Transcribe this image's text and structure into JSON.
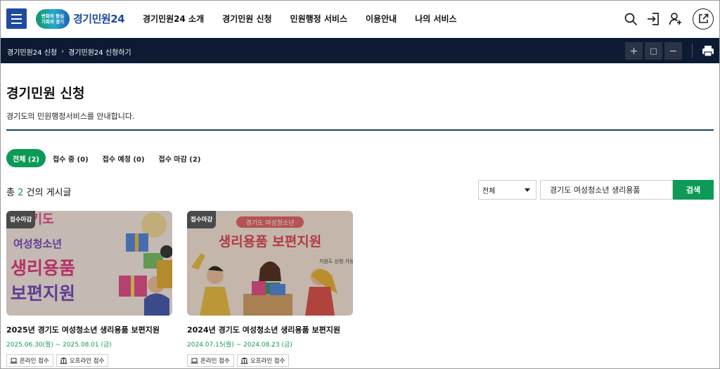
{
  "header": {
    "logo_tagline_1": "변화의 중심",
    "logo_tagline_2": "기회의 경기",
    "logo_text": "경기민원24",
    "nav": [
      "경기민원24 소개",
      "경기민원 신청",
      "민원행정 서비스",
      "이용안내",
      "나의 서비스"
    ],
    "icons": [
      "search-icon",
      "login-icon",
      "user-add-icon",
      "external-link-icon"
    ]
  },
  "breadcrumb": {
    "items": [
      "경기민원24 신청",
      "경기민원24 신청하기"
    ],
    "zoom_in": "+",
    "zoom_reset": "□",
    "zoom_out": "−"
  },
  "page": {
    "title": "경기민원 신청",
    "description": "경기도의 민원행정서비스를 안내합니다."
  },
  "tabs": [
    {
      "label": "전체 (2)",
      "active": true
    },
    {
      "label": "접수 중 (0)",
      "active": false
    },
    {
      "label": "접수 예정 (0)",
      "active": false
    },
    {
      "label": "접수 마감 (2)",
      "active": false
    }
  ],
  "count": {
    "prefix": "총",
    "number": "2",
    "suffix": "건의 게시글"
  },
  "search": {
    "select_value": "전체",
    "input_value": "경기도 여성청소년 생리용품",
    "button_label": "검색"
  },
  "cards": [
    {
      "badge": "접수마감",
      "image_text_1": "경기도",
      "image_text_2": "여성청소년",
      "image_text_3": "생리용품",
      "image_text_4": "보편지원",
      "title": "2025년 경기도 여성청소년 생리용품 보편지원",
      "date": "2025.06.30(월) ~ 2025.08.01 (금)",
      "tags": [
        "온라인 접수",
        "오프라인 접수"
      ]
    },
    {
      "badge": "접수마감",
      "image_text_1": "경기도 여성청소년",
      "image_text_2": "생리용품 보편지원",
      "image_text_3": "지원도 신청 가능!",
      "title": "2024년 경기도 여성청소년 생리용품 보편지원",
      "date": "2024.07.15(월) ~ 2024.08.23 (금)",
      "tags": [
        "온라인 접수",
        "오프라인 접수"
      ]
    }
  ],
  "colors": {
    "accent_green": "#0d9a57",
    "brand_blue": "#1f4a9e",
    "breadcrumb_bg": "#0c1a33"
  }
}
